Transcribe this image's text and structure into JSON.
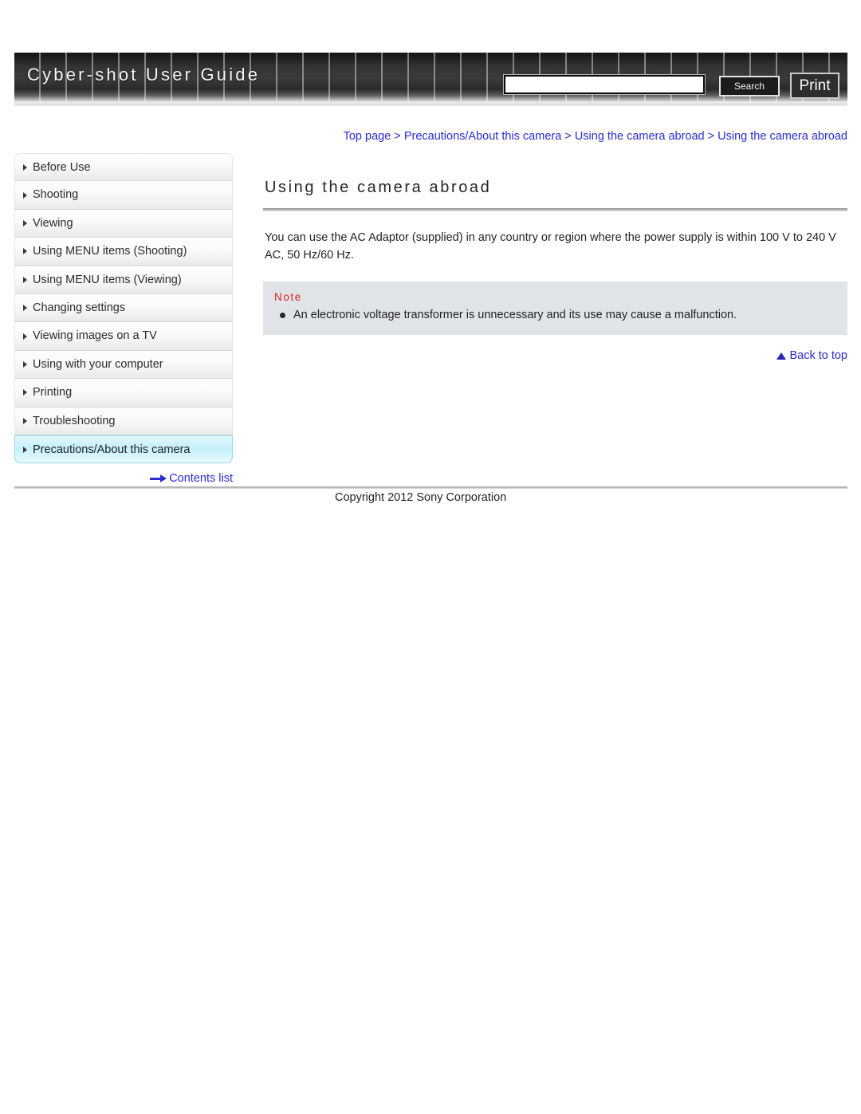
{
  "header": {
    "site_title": "Cyber-shot User Guide",
    "search_value": "",
    "search_placeholder": "",
    "search_button_label": "Search",
    "print_button_label": "Print"
  },
  "breadcrumb": {
    "separator": " > ",
    "items": [
      "Top page",
      "Precautions/About this camera",
      "Using the camera abroad",
      "Using the camera abroad"
    ]
  },
  "sidebar": {
    "items": [
      {
        "label": "Before Use",
        "active": false
      },
      {
        "label": "Shooting",
        "active": false
      },
      {
        "label": "Viewing",
        "active": false
      },
      {
        "label": "Using MENU items (Shooting)",
        "active": false
      },
      {
        "label": "Using MENU items (Viewing)",
        "active": false
      },
      {
        "label": "Changing settings",
        "active": false
      },
      {
        "label": "Viewing images on a TV",
        "active": false
      },
      {
        "label": "Using with your computer",
        "active": false
      },
      {
        "label": "Printing",
        "active": false
      },
      {
        "label": "Troubleshooting",
        "active": false
      },
      {
        "label": "Precautions/About this camera",
        "active": true
      }
    ],
    "contents_list_label": "Contents list"
  },
  "main": {
    "title": "Using the camera abroad",
    "paragraph": "You can use the AC Adaptor (supplied) in any country or region where the power supply is within 100 V to 240 V AC, 50 Hz/60 Hz.",
    "note": {
      "label": "Note",
      "items": [
        "An electronic voltage transformer is unnecessary and its use may cause a malfunction."
      ]
    },
    "back_to_top_label": "Back to top"
  },
  "footer": {
    "copyright": "Copyright 2012 Sony Corporation"
  },
  "colors": {
    "link_blue": "#2b2bd0",
    "note_red": "#dd1f1f",
    "note_bg": "#e0e3e8",
    "active_nav": "#c4f0fb"
  }
}
